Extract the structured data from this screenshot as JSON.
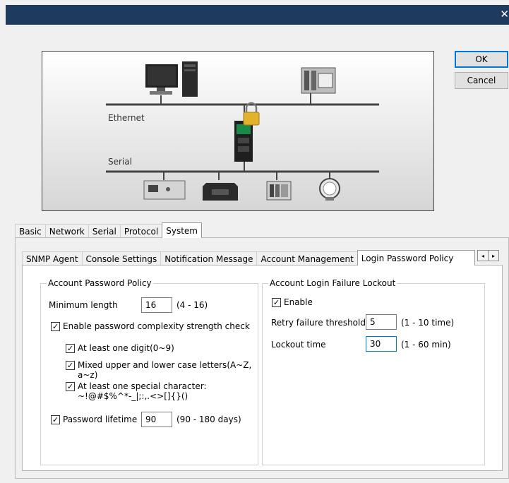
{
  "window": {
    "close_glyph": "✕"
  },
  "diagram": {
    "ethernet_label": "Ethernet",
    "serial_label": "Serial"
  },
  "actions": {
    "ok_label": "OK",
    "cancel_label": "Cancel"
  },
  "main_tabs": [
    "Basic",
    "Network",
    "Serial",
    "Protocol",
    "System"
  ],
  "sub_tabs": [
    "SNMP Agent",
    "Console Settings",
    "Notification Message",
    "Account Management",
    "Login Password Policy"
  ],
  "tab_scroll": {
    "left": "◂",
    "right": "▸"
  },
  "password_policy": {
    "title": "Account Password Policy",
    "min_length_label": "Minimum length",
    "min_length_value": "16",
    "min_length_range": "(4 - 16)",
    "complexity_label": "Enable password complexity strength check",
    "digit_label": "At least one digit(0~9)",
    "case_label_1": "Mixed upper and lower case letters(A~Z,",
    "case_label_2": "a~z)",
    "special_label_1": "At least one special character:",
    "special_label_2": "~!@#$%^*-_|;:,.<>[]{}()",
    "lifetime_label": "Password lifetime",
    "lifetime_value": "90",
    "lifetime_range": "(90 - 180 days)"
  },
  "lockout": {
    "title": "Account Login Failure Lockout",
    "enable_label": "Enable",
    "threshold_label": "Retry failure threshold",
    "threshold_value": "5",
    "threshold_range": "(1 - 10 time)",
    "lockout_time_label": "Lockout time",
    "lockout_time_value": "30",
    "lockout_time_range": "(1 - 60 min)"
  },
  "check_glyph": "✓",
  "colors": {
    "title_bar": "#1f3a5f",
    "focus": "#0078d7",
    "lock": "#e3b22c",
    "nport": "#1a8a4a"
  }
}
